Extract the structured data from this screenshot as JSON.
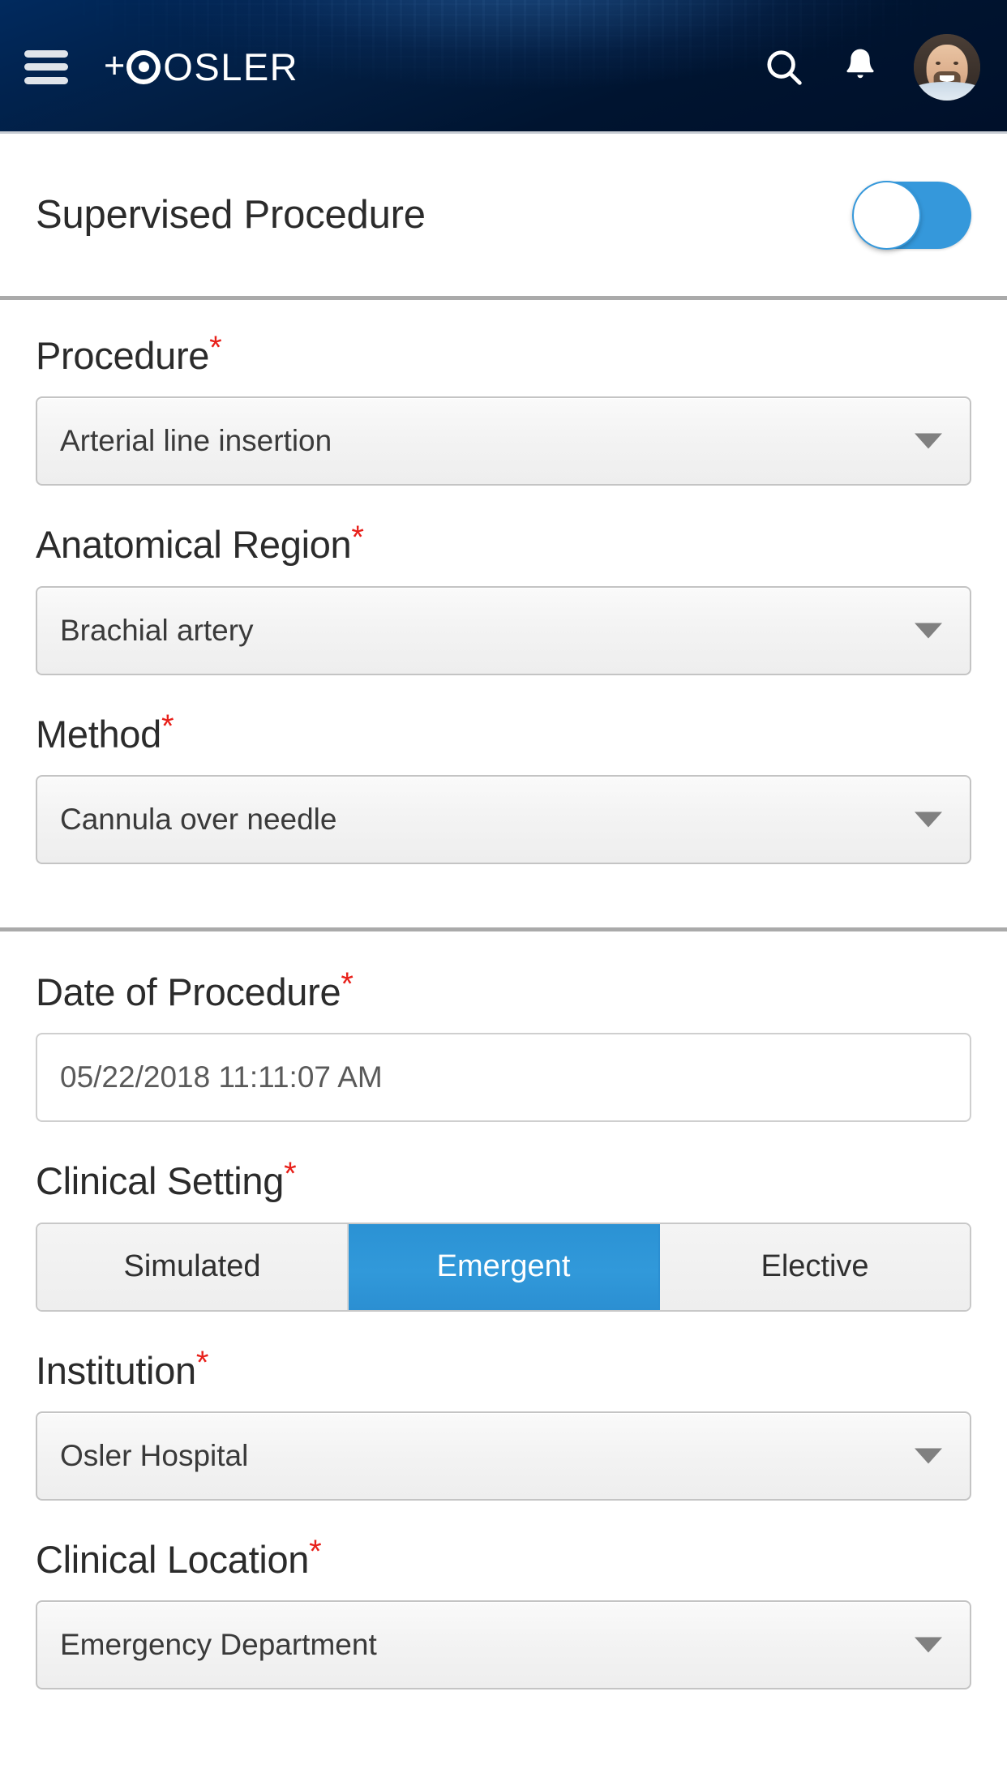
{
  "header": {
    "menu_icon": "hamburger-menu-icon",
    "brand_plus": "+",
    "brand_text": "OSLER",
    "search_icon": "search-icon",
    "notifications_icon": "bell-icon",
    "avatar_alt": "user-avatar"
  },
  "supervised": {
    "label": "Supervised Procedure",
    "toggle_on": true,
    "accent_color": "#3598db"
  },
  "required_marker": "*",
  "required_color": "#e8201a",
  "section_one": {
    "fields": [
      {
        "label": "Procedure",
        "required": true,
        "type": "select",
        "value": "Arterial line insertion"
      },
      {
        "label": "Anatomical Region",
        "required": true,
        "type": "select",
        "value": "Brachial artery"
      },
      {
        "label": "Method",
        "required": true,
        "type": "select",
        "value": "Cannula over needle"
      }
    ]
  },
  "section_two": {
    "date_field": {
      "label": "Date of Procedure",
      "required": true,
      "type": "text",
      "value": "05/22/2018 11:11:07 AM"
    },
    "clinical_setting": {
      "label": "Clinical Setting",
      "required": true,
      "type": "segmented",
      "options": [
        "Simulated",
        "Emergent",
        "Elective"
      ],
      "selected": "Emergent",
      "selected_color": "#3199da"
    },
    "institution": {
      "label": "Institution",
      "required": true,
      "type": "select",
      "value": "Osler Hospital"
    },
    "clinical_location": {
      "label": "Clinical Location",
      "required": true,
      "type": "select",
      "value": "Emergency Department"
    }
  }
}
